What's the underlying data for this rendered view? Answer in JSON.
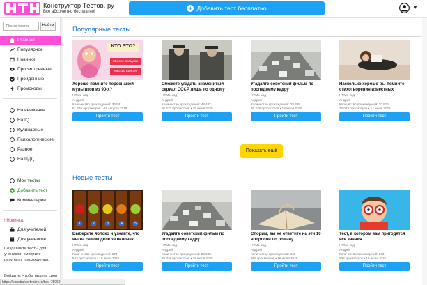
{
  "header": {
    "site_title": "Конструктор Тестов. ру",
    "site_subtitle": "Все абсолютно бесплатно!",
    "add_test_label": "Добавить тест бесплатно",
    "caret": "▾"
  },
  "sidebar": {
    "search_placeholder": "Поиск тестов",
    "search_button": "Найти",
    "main_menu": [
      {
        "label": "Главная",
        "icon": "home-icon"
      },
      {
        "label": "Популярное",
        "icon": "trending-icon"
      },
      {
        "label": "Новинки",
        "icon": "new-icon"
      },
      {
        "label": "Просмотренные",
        "icon": "eye-icon"
      },
      {
        "label": "Пройденные",
        "icon": "check-icon"
      },
      {
        "label": "Промокоды",
        "icon": "bolt-icon"
      }
    ],
    "categories": [
      {
        "label": "На внимание"
      },
      {
        "label": "На IQ"
      },
      {
        "label": "Кулинарные"
      },
      {
        "label": "Психологические"
      },
      {
        "label": "Разное"
      },
      {
        "label": "На ПДД"
      }
    ],
    "user_menu": [
      {
        "label": "Мои тесты"
      },
      {
        "label": "Добавить тест"
      },
      {
        "label": "Комментарии"
      }
    ],
    "new_badge": "! Новинка:",
    "teacher_items": [
      {
        "label": "Для учителей"
      },
      {
        "label": "Для учеников"
      }
    ],
    "teacher_text": "Создавайте тесты для учеников, смотрите результат прохождения.",
    "bottom_text": "Войдите, чтобы видеть свои",
    "status_url": "https://konstruktortestov.ru/test-75069"
  },
  "main": {
    "popular_title": "Популярные тесты",
    "new_title": "Новые тесты",
    "more_label": "Показать ещё",
    "popular_cards": [
      {
        "title": "Хорошо помните персонажей мультиков из 90-х?",
        "tag": "HTML-код",
        "author": "Андрей",
        "count": "Количество прохождений: 36 941",
        "views": "61 276 просмотров • 07 августа 2018",
        "button": "Пройти тест",
        "thumb_text1": "КТО ЭТО?",
        "thumb_text2": "Миссис Бламдин",
        "thumb_text3": "Миссис Крякли"
      },
      {
        "title": "Сможете угадать знаменитый сериал СССР лишь по одному",
        "tag": "HTML-код",
        "author": "Андрей",
        "count": "Количество прохождений: 48 487",
        "views": "95 622 просмотров • 29 июня 2025",
        "button": "Пройти тест"
      },
      {
        "title": "Угадайте советский фильм по последнему кадру",
        "tag": "HTML-код",
        "author": "Андрей",
        "count": "Количество прохождений: 28 338",
        "views": "35 338 просмотров • 18 июля 2025",
        "button": "Пройти тест"
      },
      {
        "title": "Насколько хорошо вы помните стихотворения известных",
        "tag": "HTML-код",
        "author": "Андрей",
        "count": "Количество прохождений: 20 816",
        "views": "32 074 просмотров • 14 июля 2025",
        "button": "Пройти тест"
      }
    ],
    "new_cards": [
      {
        "title": "Выберите яблоко и узнайте, что вы на самом деле за человек",
        "tag": "HTML-код",
        "author": "Андрей",
        "count": "Количество прохождений: 274",
        "views": "543 просмотров • 18 июля 2025",
        "button": "Пройти тест",
        "nums": [
          "1",
          "2",
          "3",
          "4",
          "5"
        ]
      },
      {
        "title": "Угадайте советский фильм по последнему кадру",
        "tag": "HTML-код",
        "author": "Андрей",
        "count": "Количество прохождений: 28 338",
        "views": "35 338 просмотров • 18 июля 2025",
        "button": "Пройти тест"
      },
      {
        "title": "Спорим, вы не ответите на эти 10 вопросов по роману",
        "tag": "HTML-код",
        "author": "Андрей",
        "count": "Количество прохождений: 166",
        "views": "388 просмотров • 18 июля 2025",
        "button": "Пройти тест"
      },
      {
        "title": "Тест, в котором вам пригодятся все знания",
        "tag": "HTML-код",
        "author": "Андрей",
        "count": "Количество прохождений: 233",
        "views": "532 просмотров • 18 июля 2025",
        "button": "Пройти тест"
      }
    ]
  },
  "colors": {
    "accent_blue": "#1da1f2",
    "active_pink": "#ff4fd8",
    "link_blue": "#1a73d9",
    "more_yellow": "#ffd600"
  }
}
